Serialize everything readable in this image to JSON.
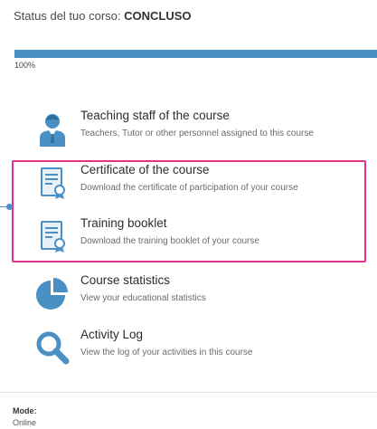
{
  "status": {
    "label": "Status del tuo corso:",
    "value": "CONCLUSO"
  },
  "progress": {
    "percent_label": "100%",
    "fraction": 1.0,
    "color": "#4a90c5"
  },
  "menu": [
    {
      "title": "Teaching staff of the course",
      "description": "Teachers, Tutor or other personnel assigned to this course",
      "icon": "teacher-person-icon"
    },
    {
      "title": "Certificate of the course",
      "description": "Download the certificate of participation of your course",
      "icon": "certificate-icon"
    },
    {
      "title": "Training booklet",
      "description": "Download the training booklet of your course",
      "icon": "certificate-icon"
    },
    {
      "title": "Course statistics",
      "description": "View your educational statistics",
      "icon": "pie-chart-icon"
    },
    {
      "title": "Activity Log",
      "description": "View the log of your activities in this course",
      "icon": "magnifier-icon"
    }
  ],
  "mode": {
    "label": "Mode:",
    "value": "Online"
  },
  "colors": {
    "accent": "#4a90c5",
    "highlight_border": "#e0338a"
  }
}
